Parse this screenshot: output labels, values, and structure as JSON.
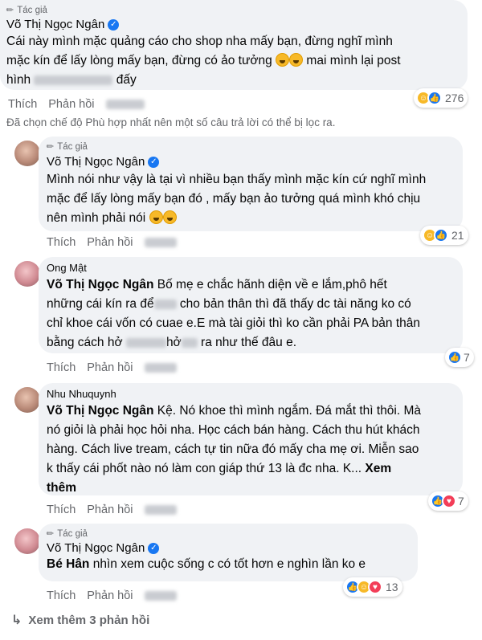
{
  "author_tag": "Tác giả",
  "action_like": "Thích",
  "action_reply": "Phản hồi",
  "top_comment": {
    "name": "Võ Thị Ngọc Ngân",
    "line1": "Cái này mình mặc quảng cáo cho shop nha mấy bạn, đừng nghĩ mình",
    "line2": "mặc kín để lấy lòng mấy bạn, đừng có ảo tưởng",
    "line2_tail": "mai mình lại post",
    "line3_pre": "hình",
    "line3_post": "đấy",
    "reaction_count": "276"
  },
  "filter_notice": "Đã chọn chế độ Phù hợp nhất nên một số câu trả lời có thể bị lọc ra.",
  "replies": [
    {
      "name": "Võ Thị Ngọc Ngân",
      "lines": [
        "Mình nói như vậy là tại vì nhiều bạn thấy mình mặc kín cứ nghĩ mình",
        "mặc để lấy lòng mấy bạn đó , mấy bạn ảo tưởng quá mình khó chịu",
        "nên mình phải nói"
      ],
      "reaction_count": "21"
    },
    {
      "name": "Ong Mật",
      "mention": "Võ Thị Ngọc Ngân",
      "line1": "Bố mẹ e chắc hãnh diện về e lắm,phô hết",
      "line2_pre": "những cái kín ra để",
      "line2_post": "cho bản thân thì đã thấy dc tài năng ko có",
      "line3": "chỉ khoe cái vốn có cuae e.E mà tài giỏi thì ko cần phải PA bản thân",
      "line4_pre": "bằng cách hở",
      "line4_mid": "hở",
      "line4_post": "ra như thế đâu e.",
      "reaction_count": "7"
    },
    {
      "name": "Nhu Nhuquynh",
      "mention": "Võ Thị Ngọc Ngân",
      "line1": "Kệ. Nó khoe thì mình ngắm. Đá mắt thì thôi. Mà",
      "line2": "nó giỏi là phải học hỏi nha. Học cách bán hàng. Cách thu hút khách",
      "line3": "hàng. Cách live tream, cách tự tin nữa đó mấy cha mẹ ơi. Miễn sao",
      "line4": "k thấy cái phốt nào nó làm con giáp thứ 13 là đc nha. K...",
      "see_more": "Xem",
      "see_more2": "thêm",
      "reaction_count": "7"
    },
    {
      "name": "Võ Thị Ngọc Ngân",
      "mention": "Bé Hân",
      "line1": "nhìn xem cuộc sống c có tốt hơn e nghìn lần ko e",
      "reaction_count": "13"
    }
  ],
  "see_more_replies": "Xem thêm 3 phản hồi",
  "colors": {
    "bubble": "#f0f2f5",
    "secondary_text": "#65676b",
    "like_blue": "#1877f2",
    "haha_yellow": "#f7b928",
    "love_red": "#f33e58"
  },
  "icons": [
    "pen-icon",
    "verified-badge-icon",
    "haha-icon",
    "like-icon",
    "love-icon",
    "reply-arrow-icon"
  ]
}
